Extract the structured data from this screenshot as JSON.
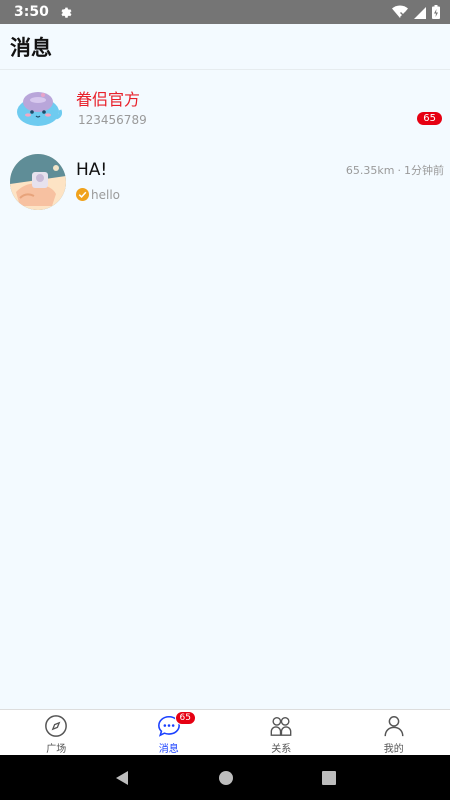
{
  "status_bar": {
    "time": "3:50"
  },
  "header": {
    "title": "消息"
  },
  "conversations": [
    {
      "name": "眷侣官方",
      "subtitle": "123456789",
      "unread": "65"
    },
    {
      "name": "HA!",
      "subtitle": "hello",
      "distance": "65.35km",
      "separator": "·",
      "time": "1分钟前"
    }
  ],
  "tabs": [
    {
      "label": "广场",
      "icon": "compass-icon"
    },
    {
      "label": "消息",
      "icon": "chat-icon",
      "badge": "65",
      "active": true
    },
    {
      "label": "关系",
      "icon": "people-icon"
    },
    {
      "label": "我的",
      "icon": "profile-icon"
    }
  ],
  "colors": {
    "accent": "#1a40ff",
    "badge": "#e60012",
    "official_name": "#e8202a",
    "background": "#f3faff"
  }
}
